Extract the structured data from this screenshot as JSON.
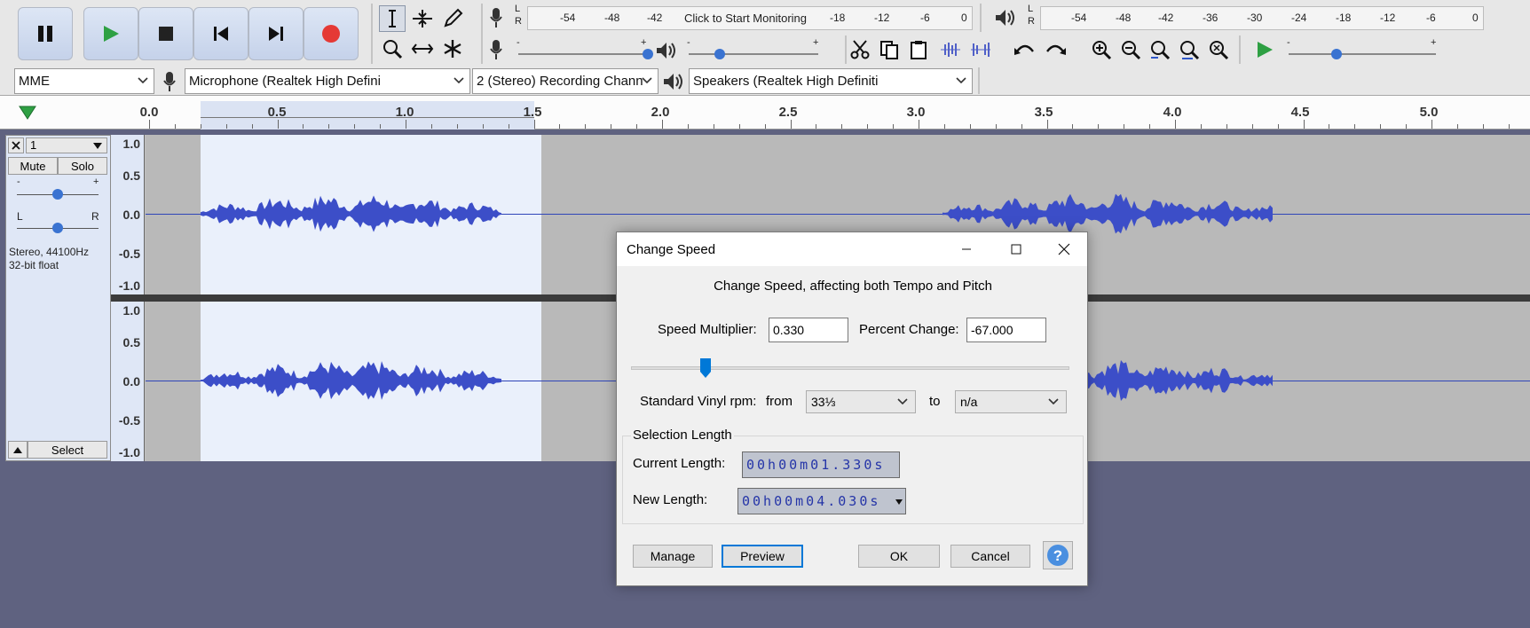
{
  "transport": {
    "buttons": [
      {
        "name": "pause-button",
        "icon": "pause-icon"
      },
      {
        "name": "play-button",
        "icon": "play-icon"
      },
      {
        "name": "stop-button",
        "icon": "stop-icon"
      },
      {
        "name": "skip-to-start-button",
        "icon": "skip-start-icon"
      },
      {
        "name": "skip-to-end-button",
        "icon": "skip-end-icon"
      },
      {
        "name": "record-button",
        "icon": "record-icon"
      }
    ]
  },
  "meters": {
    "record_scale": [
      "-54",
      "-48",
      "-42",
      "-18",
      "-12",
      "-6",
      "0"
    ],
    "record_prompt": "Click to Start Monitoring",
    "play_scale": [
      "-54",
      "-48",
      "-42",
      "-36",
      "-30",
      "-24",
      "-18",
      "-12",
      "-6",
      "0"
    ],
    "channel_l": "L",
    "channel_r": "R",
    "minus": "-",
    "plus": "+"
  },
  "device_bar": {
    "host": "MME",
    "recording_device": "Microphone (Realtek High Defini",
    "channels": "2 (Stereo) Recording Chann",
    "playback_device": "Speakers (Realtek High Definiti"
  },
  "ruler": {
    "labels": [
      "0.0",
      "0.5",
      "1.0",
      "1.5",
      "2.0",
      "2.5",
      "3.0",
      "3.5",
      "4.0",
      "4.5",
      "5.0"
    ]
  },
  "track": {
    "name": "1",
    "mute_label": "Mute",
    "solo_label": "Solo",
    "gain_minus": "-",
    "gain_plus": "+",
    "pan_l": "L",
    "pan_r": "R",
    "info_line1": "Stereo, 44100Hz",
    "info_line2": "32-bit float",
    "select_label": "Select",
    "scale": [
      "1.0",
      "0.5",
      "0.0",
      "-0.5",
      "-1.0"
    ]
  },
  "dialog": {
    "title": "Change Speed",
    "heading": "Change Speed, affecting both Tempo and Pitch",
    "speed_multiplier_label": "Speed Multiplier:",
    "speed_multiplier_value": "0.330",
    "percent_change_label": "Percent Change:",
    "percent_change_value": "-67.000",
    "slider_fraction": 0.17,
    "vinyl_label": "Standard Vinyl rpm:",
    "from_label": "from",
    "from_value": "33⅓",
    "to_label": "to",
    "to_value": "n/a",
    "selection_group": "Selection Length",
    "current_length_label": "Current Length:",
    "current_length_value": "00h00m01.330s",
    "new_length_label": "New Length:",
    "new_length_value": "00h00m04.030s",
    "buttons": {
      "manage": "Manage",
      "preview": "Preview",
      "ok": "OK",
      "cancel": "Cancel"
    }
  },
  "colors": {
    "waveform": "#3c4ec8",
    "selection": "#eaf0fb",
    "accent": "#0078d7",
    "record": "#e53935",
    "play": "#2ea043"
  }
}
